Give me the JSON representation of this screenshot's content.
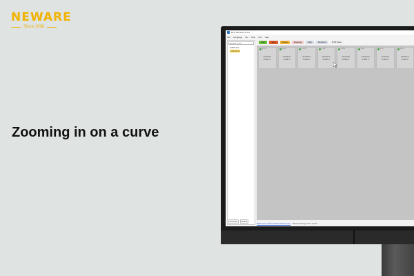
{
  "logo": {
    "word": "NEWARE",
    "tagline": "Since 1998"
  },
  "headline": "Zooming in on a curve",
  "app": {
    "title": "BTS Client 8.0.0.xxx",
    "menu": [
      "File",
      "Language",
      "Set",
      "View",
      "Tool",
      "Help"
    ],
    "sidebar": {
      "search": "Device 1 Ltd",
      "tree_root": "BTS 8.0",
      "tree_selected": "127.0.0.1",
      "tabs": [
        "Process",
        "Ch1-8"
      ]
    },
    "toolbar": [
      {
        "label": "Start",
        "color": "#6cbf3a"
      },
      {
        "label": "Stop",
        "color": "#e25a2c"
      },
      {
        "label": "Pause",
        "color": "#f2b233"
      },
      {
        "label": "Resume",
        "color": "#f0c7c7"
      },
      {
        "label": "Skip",
        "color": "#d6dbe6"
      },
      {
        "label": "Finished",
        "color": "#d6dbe6"
      },
      {
        "label": "BTS View",
        "color": "#eeeeee"
      }
    ],
    "channels": [
      {
        "head": "1-1-1",
        "status": "Finished",
        "voltage": "0.000 V"
      },
      {
        "head": "1-1-2",
        "status": "Finished",
        "voltage": "0.000 V"
      },
      {
        "head": "1-1-3",
        "status": "Finished",
        "voltage": "0.000 V"
      },
      {
        "head": "1-1-4",
        "status": "Finished",
        "voltage": "0.000 V"
      },
      {
        "head": "1-1-5",
        "status": "Finished",
        "voltage": "0.000 V"
      },
      {
        "head": "1-1-6",
        "status": "Finished",
        "voltage": "0.000 V"
      },
      {
        "head": "1-1-7",
        "status": "Finished",
        "voltage": "0.000 V"
      },
      {
        "head": "1-1-8",
        "status": "Finished",
        "voltage": "0.000 V"
      }
    ],
    "status": {
      "link": "Welcome to https://www.neware.com",
      "text": "Reconnecting to the server"
    }
  },
  "colors": {
    "brand": "#f1b300",
    "background": "#dfe3e2"
  }
}
